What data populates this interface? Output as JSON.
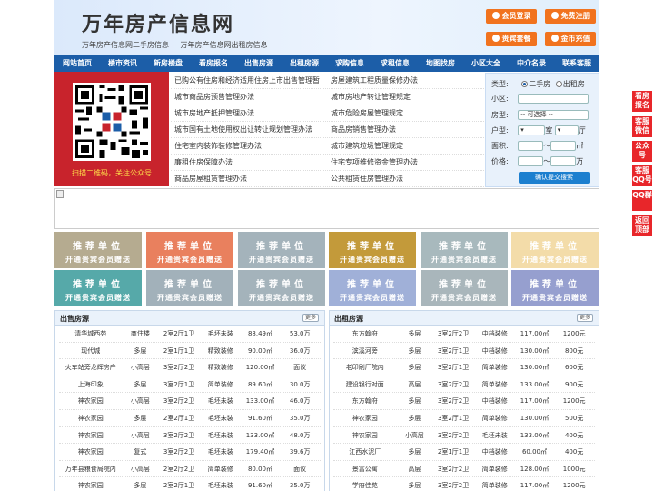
{
  "header": {
    "title": "万年房产信息网",
    "subtitle": [
      "万年房产信息网二手房信息",
      "万年房产信息网出租房信息"
    ],
    "buttons": [
      "会员登录",
      "免费注册",
      "贵宾套餐",
      "金币充值"
    ]
  },
  "nav": [
    "网站首页",
    "楼市资讯",
    "新房楼盘",
    "看房报名",
    "出售房源",
    "出租房源",
    "求购信息",
    "求租信息",
    "地图找房",
    "小区大全",
    "中介名录",
    "联系客服"
  ],
  "qr": {
    "caption": "扫描二维码，关注公众号"
  },
  "links": [
    [
      "已购公有住房和经济适用住房上市出售管理暂",
      "房屋建筑工程质量保修办法"
    ],
    [
      "城市商品房预售管理办法",
      "城市房地产转让管理规定"
    ],
    [
      "城市房地产抵押管理办法",
      "城市危险房屋管理规定"
    ],
    [
      "城市国有土地使用权出让转让规划管理办法",
      "商品房销售管理办法"
    ],
    [
      "住宅室内装饰装修管理办法",
      "城市建筑垃圾管理规定"
    ],
    [
      "廉租住房保障办法",
      "住宅专项维修资金管理办法"
    ],
    [
      "商品房屋租赁管理办法",
      "公共租赁住房管理办法"
    ]
  ],
  "search": {
    "type_label": "类型:",
    "type_options": [
      "二手房",
      "出租房"
    ],
    "community_label": "小区:",
    "house_type_label": "房型:",
    "house_type_value": "-- 可选择 --",
    "layout_label": "户型:",
    "layout_room": "室",
    "layout_hall": "厅",
    "area_label": "面积:",
    "area_unit": "㎡",
    "price_label": "价格:",
    "price_unit": "万",
    "range_sep": "～",
    "submit": "确认提交搜索"
  },
  "ads": {
    "line1": "推荐单位",
    "line2": "开通贵宾会员赠送",
    "colors": [
      "#b5ab90",
      "#e9805e",
      "#a4b3bb",
      "#c39a3a",
      "#a8b9bd",
      "#f3dca9",
      "#56a9a9",
      "#a2b1ba",
      "#a4b3bb",
      "#a0b0d8",
      "#a9b6bb",
      "#969fcf"
    ]
  },
  "sale": {
    "title": "出售房源",
    "more": "更多",
    "rows": [
      [
        "清华城西苑",
        "商住楼",
        "2室2厅1卫",
        "毛坯未装",
        "88.49㎡",
        "53.0万"
      ],
      [
        "现代城",
        "多层",
        "2室1厅1卫",
        "精致装修",
        "90.00㎡",
        "36.0万"
      ],
      [
        "火车站旁龙辉房产",
        "小高层",
        "3室2厅2卫",
        "精致装修",
        "120.00㎡",
        "面议"
      ],
      [
        "上海印象",
        "多层",
        "3室2厅1卫",
        "简单装修",
        "89.60㎡",
        "30.0万"
      ],
      [
        "神农家园",
        "小高层",
        "3室2厅2卫",
        "毛坯未装",
        "133.00㎡",
        "46.0万"
      ],
      [
        "神农家园",
        "多层",
        "2室2厅1卫",
        "毛坯未装",
        "91.60㎡",
        "35.0万"
      ],
      [
        "神农家园",
        "小高层",
        "3室2厅2卫",
        "毛坯未装",
        "133.00㎡",
        "48.0万"
      ],
      [
        "神农家园",
        "复式",
        "3室2厅2卫",
        "毛坯未装",
        "179.40㎡",
        "39.6万"
      ],
      [
        "万年县粮食局院内",
        "小高层",
        "2室2厅2卫",
        "简单装修",
        "80.00㎡",
        "面议"
      ],
      [
        "神农家园",
        "多层",
        "2室2厅1卫",
        "毛坯未装",
        "91.60㎡",
        "35.0万"
      ]
    ]
  },
  "rent": {
    "title": "出租房源",
    "more": "更多",
    "rows": [
      [
        "东方翰府",
        "多层",
        "3室2厅2卫",
        "中档装修",
        "117.00㎡",
        "1200元"
      ],
      [
        "滨溪河旁",
        "多层",
        "3室2厅1卫",
        "中档装修",
        "130.00㎡",
        "800元"
      ],
      [
        "老印刷厂院内",
        "多层",
        "3室2厅1卫",
        "简单装修",
        "130.00㎡",
        "600元"
      ],
      [
        "建设银行对面",
        "高层",
        "3室2厅2卫",
        "简单装修",
        "133.00㎡",
        "900元"
      ],
      [
        "东方翰府",
        "多层",
        "3室2厅2卫",
        "中档装修",
        "117.00㎡",
        "1200元"
      ],
      [
        "神农家园",
        "多层",
        "3室2厅1卫",
        "简单装修",
        "130.00㎡",
        "500元"
      ],
      [
        "神农家园",
        "小高层",
        "3室2厅2卫",
        "毛坯未装",
        "133.00㎡",
        "400元"
      ],
      [
        "江西水泥厂",
        "多层",
        "2室1厅1卫",
        "中档装修",
        "60.00㎡",
        "400元"
      ],
      [
        "景富公寓",
        "高层",
        "3室2厅2卫",
        "简单装修",
        "128.00㎡",
        "1000元"
      ],
      [
        "学府佳苑",
        "多层",
        "3室2厅2卫",
        "简单装修",
        "117.00㎡",
        "1200元"
      ]
    ]
  },
  "float": [
    "看房报名",
    "客服微信",
    "公众号",
    "客服QQ号",
    "QQ群",
    "返回顶部"
  ]
}
